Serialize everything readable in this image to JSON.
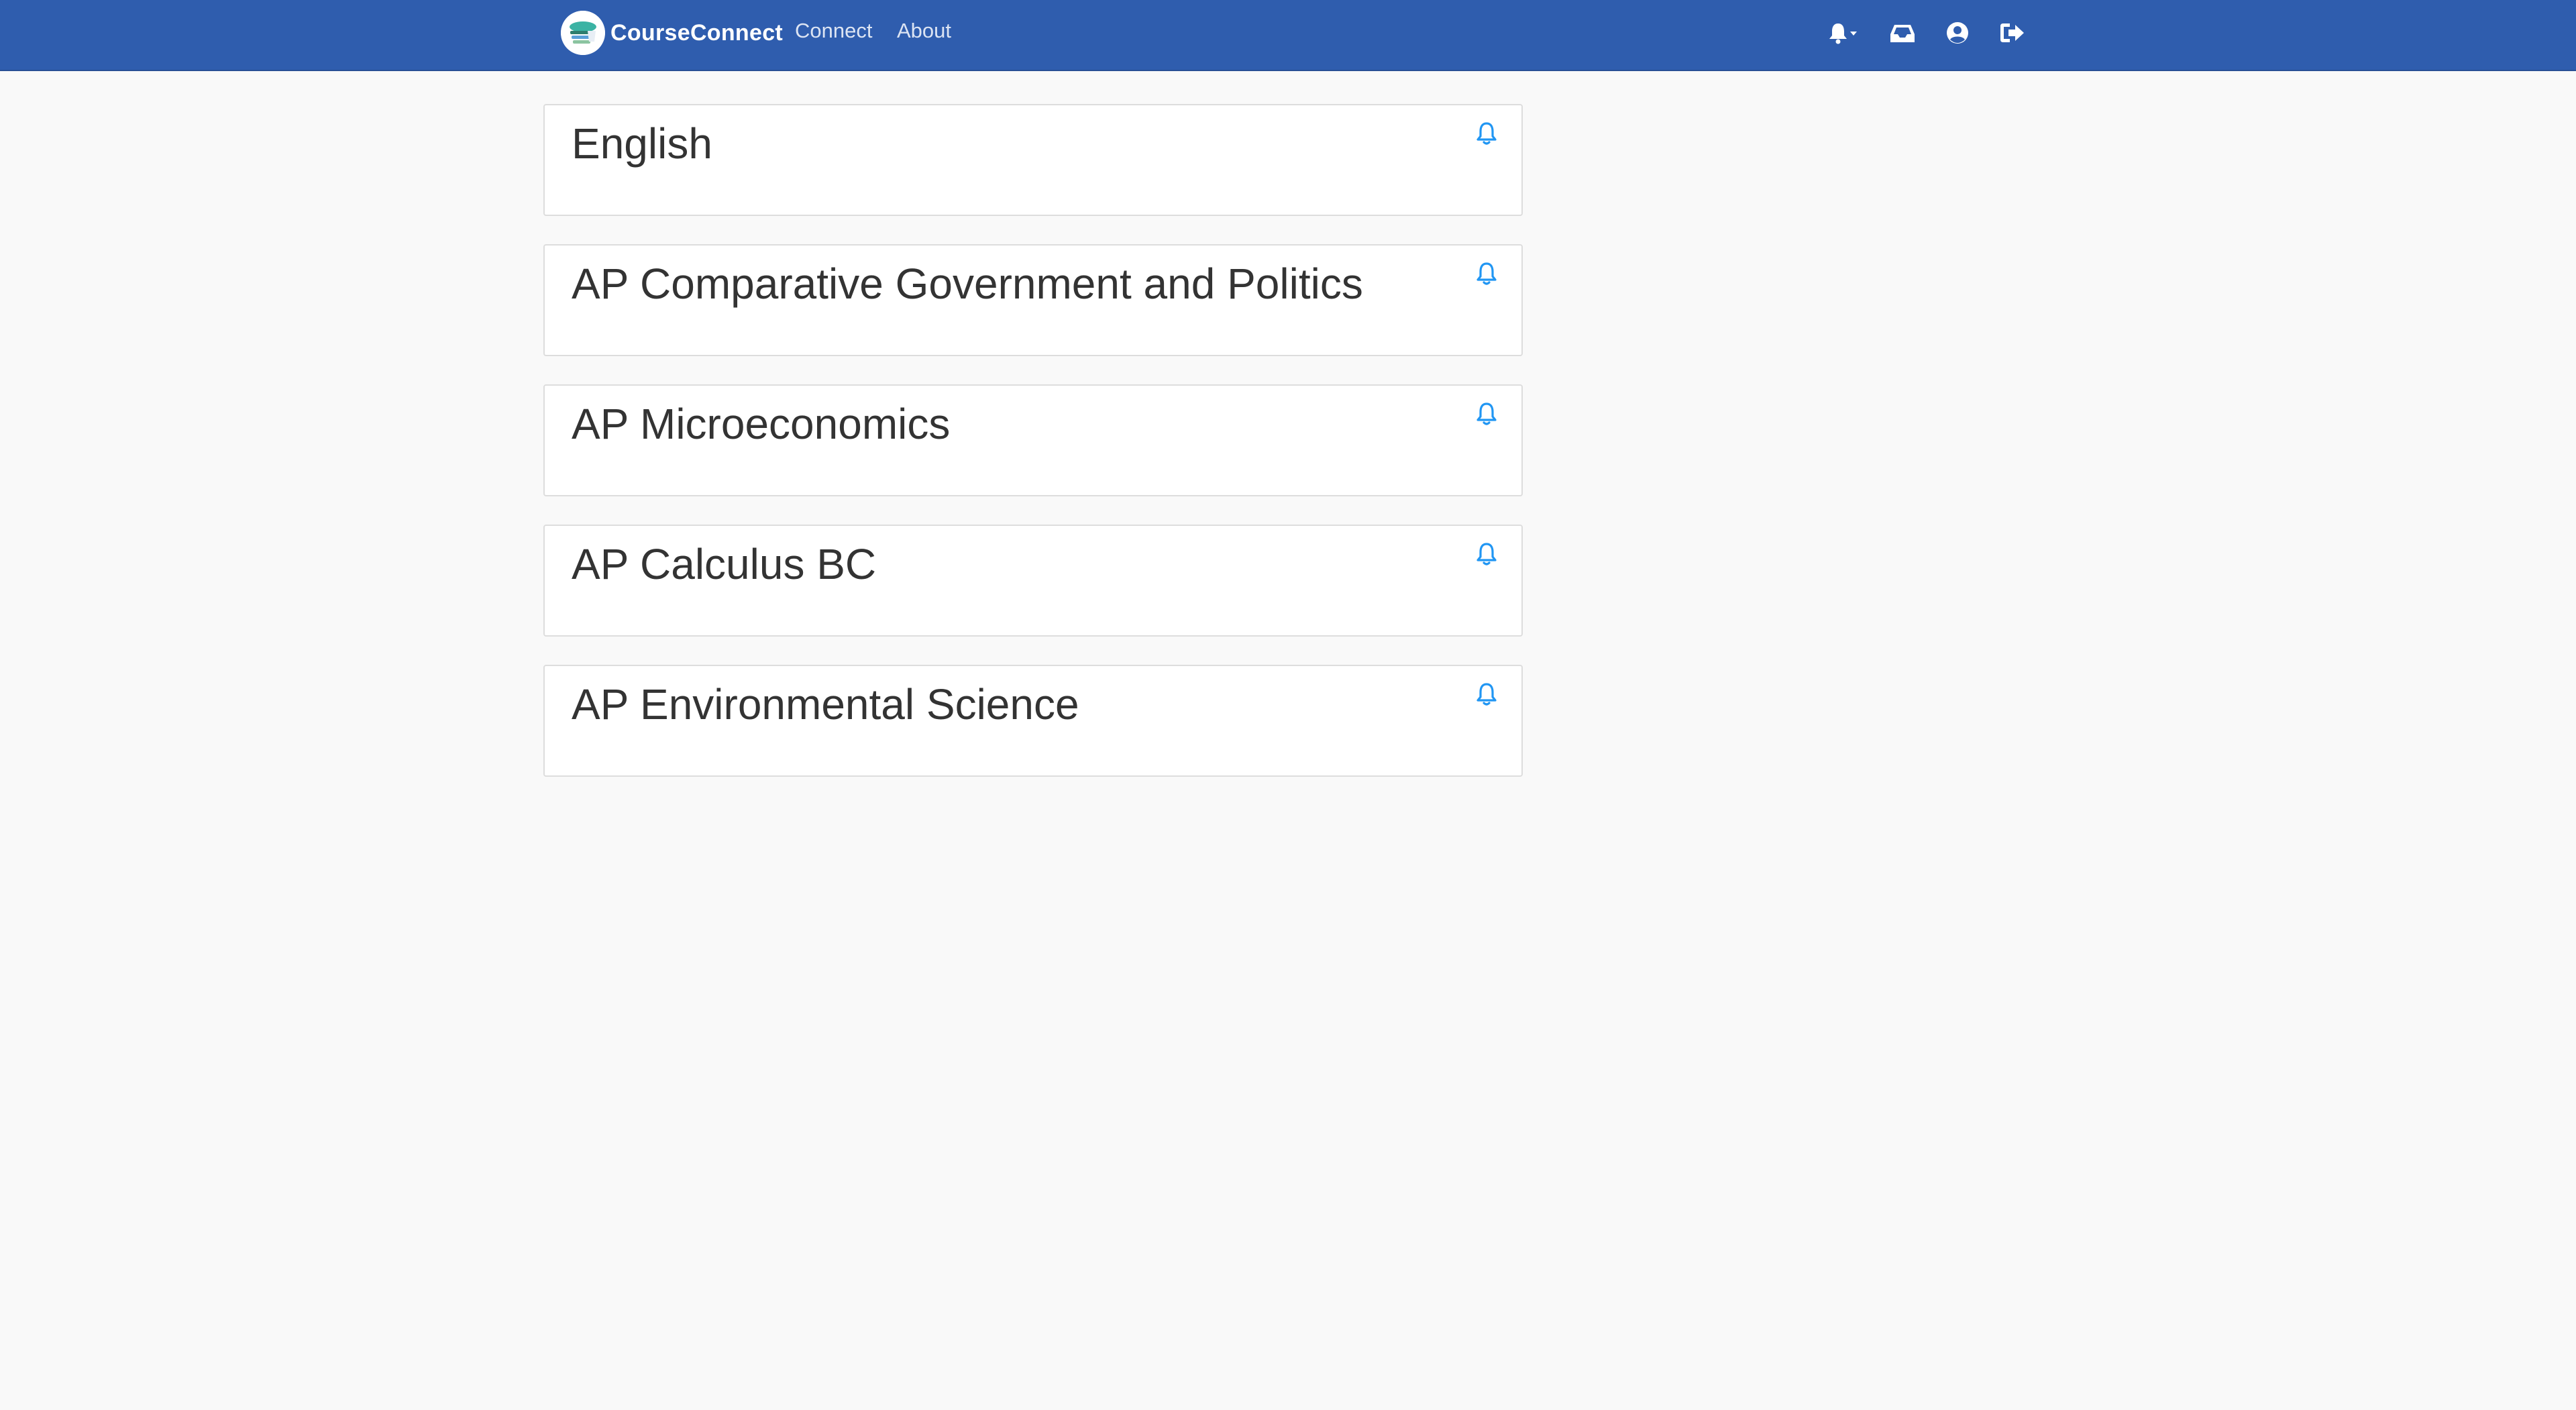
{
  "app": {
    "name": "CourseConnect"
  },
  "nav": {
    "links": [
      {
        "label": "Connect"
      },
      {
        "label": "About"
      }
    ],
    "icons": [
      "bell-dropdown-icon",
      "inbox-icon",
      "user-circle-icon",
      "logout-icon"
    ]
  },
  "courses": [
    {
      "title": "English"
    },
    {
      "title": "AP Comparative Government and Politics"
    },
    {
      "title": "AP Microeconomics"
    },
    {
      "title": "AP Calculus BC"
    },
    {
      "title": "AP Environmental Science"
    }
  ],
  "colors": {
    "navbar": "#2f5dae",
    "background": "#f9f9f9",
    "accent": "#2196f3",
    "title_text": "#333333"
  }
}
